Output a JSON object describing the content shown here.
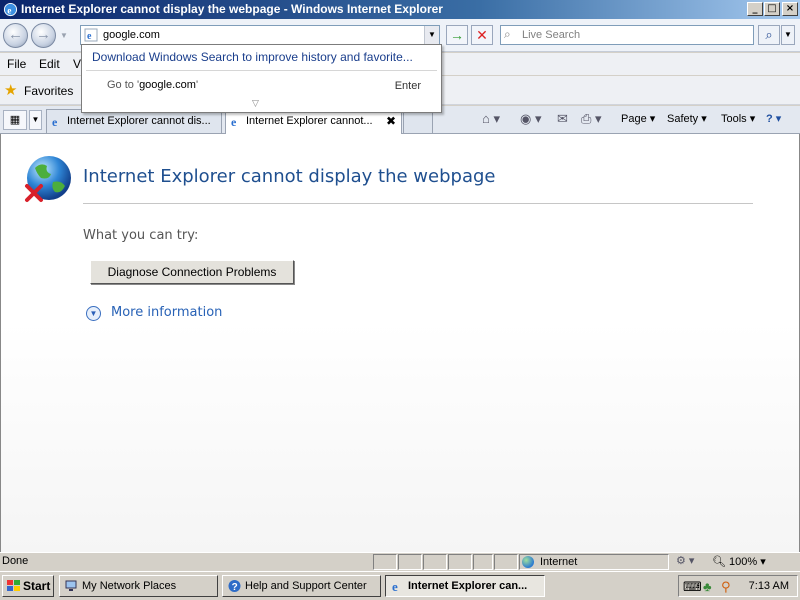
{
  "window": {
    "title": "Internet Explorer cannot display the webpage - Windows Internet Explorer",
    "controls": {
      "minimize": "_",
      "maximize": "□",
      "close": "×"
    }
  },
  "nav": {
    "back_glyph": "←",
    "forward_glyph": "→",
    "address_value": "google.com",
    "go_glyph": "→",
    "stop_glyph": "✕",
    "search_placeholder": "Live Search",
    "search_glyph": "⌕"
  },
  "autocomplete": {
    "link": "Download Windows Search to improve history and favorite...",
    "goto_prefix": "Go to '",
    "goto_value": "google.com",
    "goto_suffix": "'",
    "enter_label": "Enter"
  },
  "menu": {
    "items": [
      "File",
      "Edit",
      "V"
    ]
  },
  "favorites": {
    "label": "Favorites"
  },
  "tabs": [
    {
      "label": "Internet Explorer cannot dis..."
    },
    {
      "label": "Internet Explorer cannot...",
      "close": "✖"
    }
  ],
  "commands": {
    "page": "Page ▾",
    "safety": "Safety ▾",
    "tools": "Tools ▾",
    "help": "? ▾"
  },
  "content": {
    "title": "Internet Explorer cannot display the webpage",
    "try_text": "What you can try:",
    "diagnose_button": "Diagnose Connection Problems",
    "more_info": "More information"
  },
  "status": {
    "text": "Done",
    "zone": "Internet",
    "zoom": "100%"
  },
  "taskbar": {
    "start": "Start",
    "tasks": [
      {
        "label": "My Network Places"
      },
      {
        "label": "Help and Support Center"
      },
      {
        "label": "Internet Explorer can..."
      }
    ],
    "clock": "7:13 AM"
  },
  "colors": {
    "title_blue": "#1f4f8f",
    "link_blue": "#2862b6",
    "titlebar": "#0a246a"
  }
}
